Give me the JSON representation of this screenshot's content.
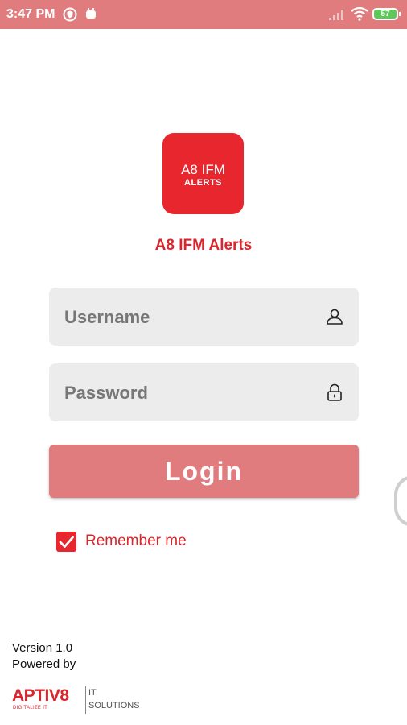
{
  "status_bar": {
    "time": "3:47 PM",
    "battery": "57",
    "icons": [
      "shield-icon",
      "notification-icon",
      "signal-icon",
      "wifi-icon",
      "battery-icon"
    ]
  },
  "app": {
    "logo_line1": "A8 IFM",
    "logo_line2": "ALERTS",
    "name": "A8 IFM Alerts"
  },
  "form": {
    "username_placeholder": "Username",
    "password_placeholder": "Password",
    "login_label": "Login",
    "remember_label": "Remember me",
    "remember_checked": true
  },
  "footer": {
    "version": "Version 1.0",
    "powered_by": "Powered by",
    "brand_name": "APTIV8",
    "brand_tagline": "DIGITALIZE IT",
    "brand_it": "IT",
    "brand_solutions": "SOLUTIONS"
  },
  "colors": {
    "accent": "#e8262d",
    "status_bar": "#e07b7e",
    "button": "#e07b7e",
    "field_bg": "#ececec"
  }
}
